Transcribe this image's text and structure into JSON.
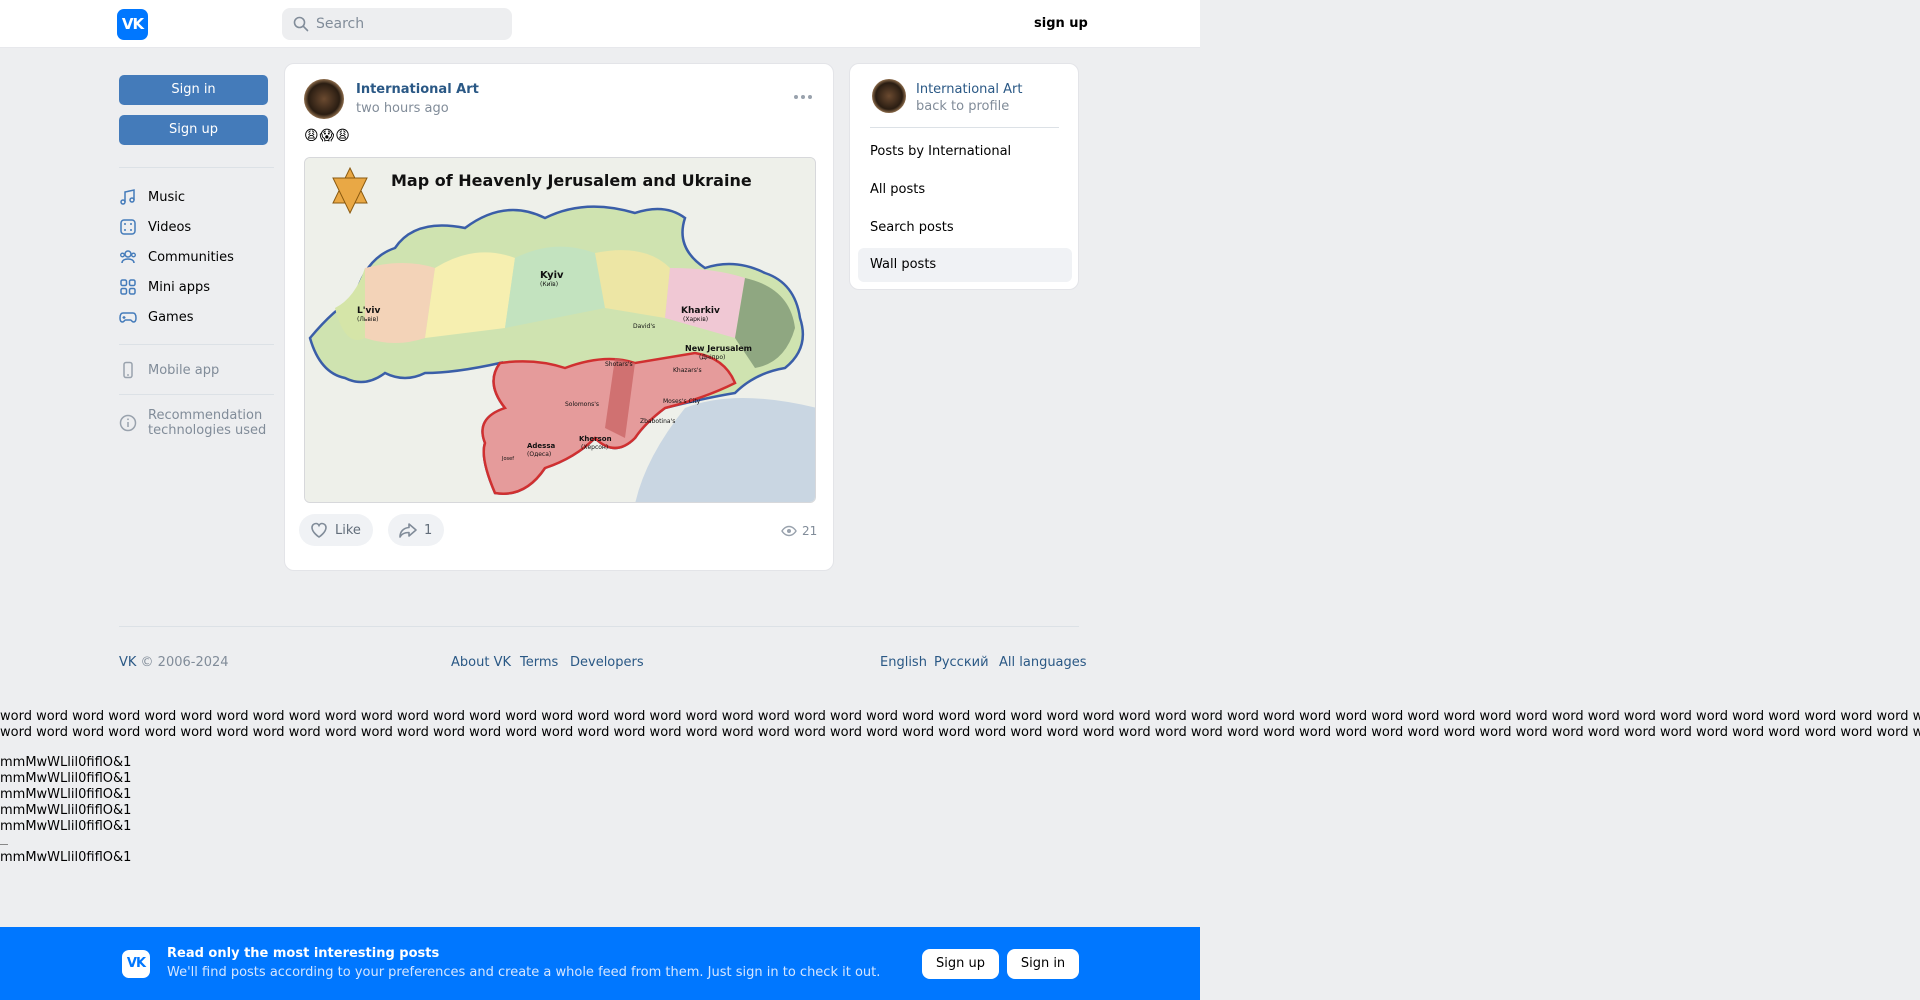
{
  "header": {
    "logo": "VK",
    "search_placeholder": "Search",
    "signup_link": "sign up"
  },
  "sidebar": {
    "sign_in": "Sign in",
    "sign_up": "Sign up",
    "items": [
      {
        "label": "Music",
        "icon": "music-icon"
      },
      {
        "label": "Videos",
        "icon": "videos-icon"
      },
      {
        "label": "Communities",
        "icon": "communities-icon"
      },
      {
        "label": "Mini apps",
        "icon": "mini-apps-icon"
      },
      {
        "label": "Games",
        "icon": "games-icon"
      }
    ],
    "mobile_app": "Mobile app",
    "recommendation": "Recommendation technologies used"
  },
  "post": {
    "author": "International Art",
    "time": "two hours ago",
    "emojis": "😩😱😩",
    "map_title": "Map of Heavenly Jerusalem and Ukraine",
    "map_labels": {
      "lviv": "L'viv",
      "lviv_sub": "(Львів)",
      "kyiv": "Kyiv",
      "kyiv_sub": "(Київ)",
      "kharkiv": "Kharkiv",
      "kharkiv_sub": "(Харків)",
      "new_jerusalem": "New Jerusalem",
      "new_jerusalem_sub": "(Дніпро)",
      "odessa": "Adessa",
      "odessa_sub": "(Одеса)",
      "kherson": "Kherson",
      "kherson_sub": "(Херсон)",
      "davids": "David's",
      "shotars": "Shotars's",
      "khazars": "Khazars's",
      "solomons": "Solomons's",
      "mosesh": "Moses's City",
      "zbabotina": "Zbabotina's",
      "josef": "Josef"
    },
    "like_label": "Like",
    "share_count": "1",
    "views": "21"
  },
  "right_card": {
    "name": "International Art",
    "back": "back to profile",
    "items": [
      "Posts by International",
      "All posts",
      "Search posts",
      "Wall posts"
    ]
  },
  "footer": {
    "copyright": "VK © 2006-2024",
    "links": [
      "About VK",
      "Terms",
      "Developers"
    ],
    "languages": [
      "English",
      "Русский",
      "All languages"
    ]
  },
  "filler": {
    "words_line1": "word word word word word word word word word word word word word word word word word word word word word word word word word word word word word word word word word word word word word word word word word word word word word word word word word word word word word word word word word word word word word word",
    "words_line2": "word word word word word word word word word word word word word word word word word word word word word word word word word word word word word word word word word word word word word word word word word word word word word word word word word word word word word word word word word word word word word",
    "mline": "mmMwWLlil0fiflO&1"
  },
  "banner": {
    "logo": "VK",
    "title": "Read only the most interesting posts",
    "subtitle": "We'll find posts according to your preferences and create a whole feed from them. Just sign in to check it out.",
    "sign_up": "Sign up",
    "sign_in": "Sign in"
  },
  "colors": {
    "accent": "#0077ff",
    "button": "#447bba",
    "link": "#2a5885",
    "background": "#edeef0"
  }
}
